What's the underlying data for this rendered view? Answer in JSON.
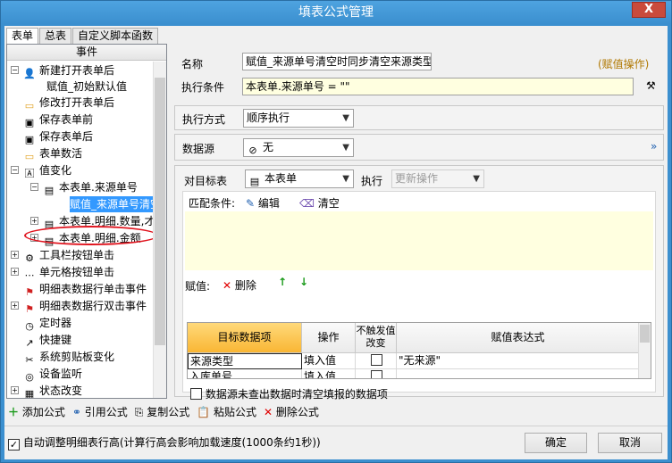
{
  "window": {
    "title": "填表公式管理",
    "close_label": "X"
  },
  "tabs": [
    "表单",
    "总表",
    "自定义脚本函数"
  ],
  "tree": {
    "header": "事件",
    "items": [
      {
        "label": "新建打开表单后",
        "icon": "person-icon"
      },
      {
        "label": "赋值_初始默认值",
        "icon": ""
      },
      {
        "label": "修改打开表单后",
        "icon": "folder-icon"
      },
      {
        "label": "保存表单前",
        "icon": "save-icon"
      },
      {
        "label": "保存表单后",
        "icon": "save-icon"
      },
      {
        "label": "表单数活",
        "icon": "folder-icon"
      },
      {
        "label": "值变化",
        "icon": "value-icon"
      },
      {
        "label": "本表单.来源单号",
        "icon": "form-icon"
      },
      {
        "label": "赋值_来源单号清空",
        "icon": ""
      },
      {
        "label": "本表单.明细.数量,才",
        "icon": "form-icon"
      },
      {
        "label": "本表单.明细.金额",
        "icon": "form-icon"
      },
      {
        "label": "工具栏按钮单击",
        "icon": "toolbar-icon"
      },
      {
        "label": "单元格按钮单击",
        "icon": "dots-icon"
      },
      {
        "label": "明细表数据行单击事件",
        "icon": "flag-icon"
      },
      {
        "label": "明细表数据行双击事件",
        "icon": "flag-icon"
      },
      {
        "label": "定时器",
        "icon": "timer-icon"
      },
      {
        "label": "快捷键",
        "icon": "shortcut-icon"
      },
      {
        "label": "系统剪贴板变化",
        "icon": "scissors-icon"
      },
      {
        "label": "设备监听",
        "icon": "device-icon"
      },
      {
        "label": "状态改变",
        "icon": "status-icon"
      }
    ]
  },
  "form": {
    "name_label": "名称",
    "name_value": "赋值_来源单号清空时同步清空来源类型",
    "name_tag": "(赋值操作)",
    "cond_label": "执行条件",
    "cond_value": "本表单.来源单号 = \"\"",
    "mode_label": "执行方式",
    "mode_value": "顺序执行",
    "source_label": "数据源",
    "source_value": "无",
    "target_label": "对目标表",
    "target_value": "本表单",
    "exec_label": "执行",
    "exec_value": "更新操作",
    "match_label": "匹配条件:",
    "edit_label": "编辑",
    "clear_label": "清空",
    "assign_label": "赋值:",
    "delete_label": "删除",
    "grid_headers": [
      "目标数据项",
      "操作",
      "不触发值改变",
      "赋值表达式"
    ],
    "grid_rows": [
      {
        "target": "来源类型",
        "op": "填入值",
        "expr": "\"无来源\""
      },
      {
        "target": "入库单号",
        "op": "填入值",
        "expr": ""
      }
    ],
    "clear_option": "数据源未查出数据时清空填报的数据项"
  },
  "toolbar": {
    "add": "添加公式",
    "ref": "引用公式",
    "copy": "复制公式",
    "paste": "粘贴公式",
    "delete": "删除公式"
  },
  "footer": {
    "auto_height": "自动调整明细表行高(计算行高会影响加载速度(1000条约1秒))",
    "ok": "确定",
    "cancel": "取消"
  }
}
